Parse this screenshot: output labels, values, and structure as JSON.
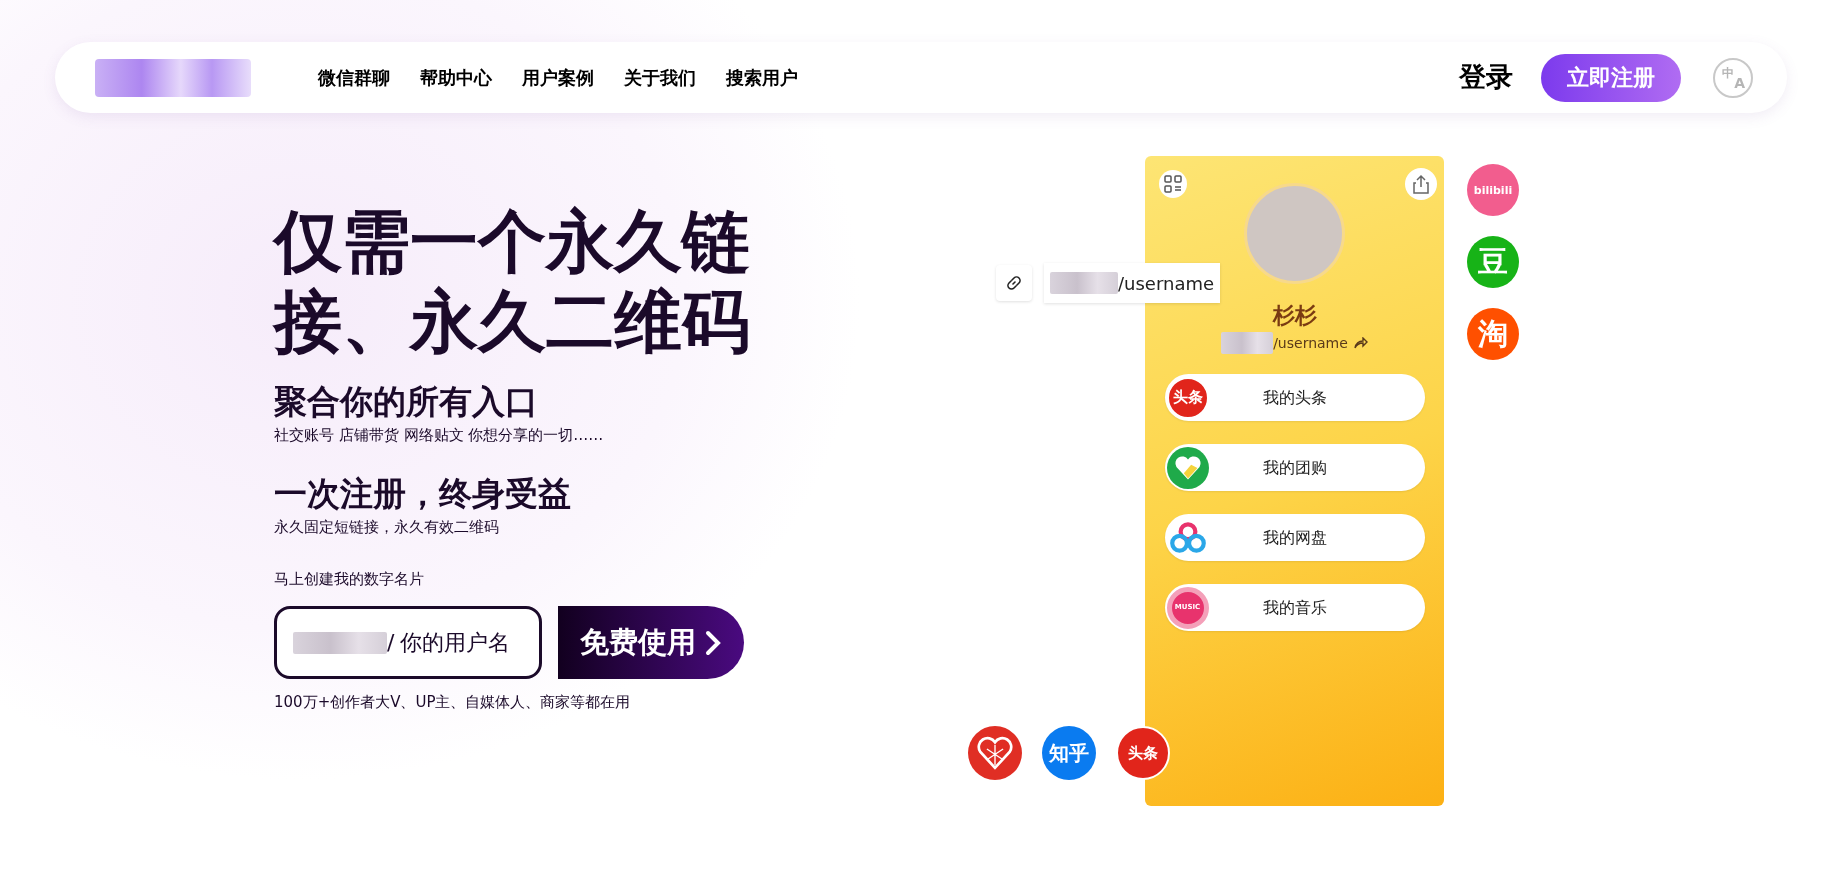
{
  "nav": {
    "links": [
      "微信群聊",
      "帮助中心",
      "用户案例",
      "关于我们",
      "搜索用户"
    ],
    "login": "登录",
    "register": "立即注册",
    "language": {
      "top": "中",
      "bottom": "A"
    }
  },
  "hero": {
    "title": "仅需一个永久链接、永久二维码",
    "sections": [
      {
        "heading": "聚合你的所有入口",
        "text": "社交账号 店铺带货 网络贴文 你想分享的一切……"
      },
      {
        "heading": "一次注册，终身受益",
        "text": "永久固定短链接，永久有效二维码"
      }
    ],
    "cta_label": "马上创建我的数字名片",
    "field": {
      "separator": "/",
      "placeholder": "你的用户名"
    },
    "button": "免费使用",
    "footnote": "100万+创作者大V、UP主、自媒体人、商家等都在用"
  },
  "profile": {
    "link_chip": "/username",
    "name": "杉杉",
    "url": "/username",
    "links": [
      {
        "kind": "toutiao",
        "icon_text": "头条",
        "label": "我的头条"
      },
      {
        "kind": "tuangou",
        "label": "我的团购"
      },
      {
        "kind": "pan",
        "label": "我的网盘"
      },
      {
        "kind": "music",
        "icon_text": "MUSIC",
        "label": "我的音乐"
      }
    ],
    "side_icons": [
      {
        "kind": "bilibili",
        "text": "bilibili"
      },
      {
        "kind": "douban",
        "text": "豆"
      },
      {
        "kind": "taobao",
        "text": "淘"
      }
    ],
    "bottom_icons": [
      {
        "kind": "pdd"
      },
      {
        "kind": "zhihu",
        "text": "知乎"
      },
      {
        "kind": "toutiao",
        "text": "头条"
      }
    ]
  }
}
